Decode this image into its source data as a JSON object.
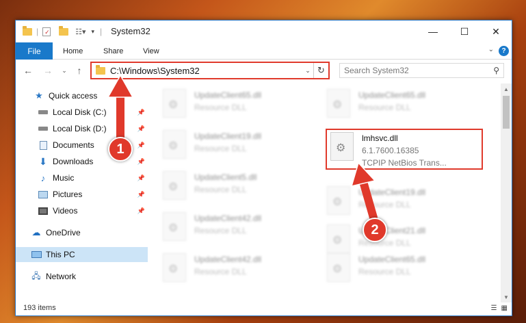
{
  "window": {
    "title": "System32",
    "minimize": "—",
    "maximize": "☐",
    "close": "✕"
  },
  "ribbon": {
    "tabs": [
      "File",
      "Home",
      "Share",
      "View"
    ],
    "help": "?"
  },
  "nav": {
    "address": "C:\\Windows\\System32",
    "search_placeholder": "Search System32"
  },
  "sidebar": {
    "items": [
      {
        "label": "Quick access",
        "icon": "star-icon"
      },
      {
        "label": "Local Disk (C:)",
        "icon": "drive-icon"
      },
      {
        "label": "Local Disk (D:)",
        "icon": "drive-icon"
      },
      {
        "label": "Documents",
        "icon": "documents-icon"
      },
      {
        "label": "Downloads",
        "icon": "download-icon"
      },
      {
        "label": "Music",
        "icon": "music-icon"
      },
      {
        "label": "Pictures",
        "icon": "pictures-icon"
      },
      {
        "label": "Videos",
        "icon": "videos-icon"
      },
      {
        "label": "OneDrive",
        "icon": "cloud-icon"
      },
      {
        "label": "This PC",
        "icon": "computer-icon"
      },
      {
        "label": "Network",
        "icon": "network-icon"
      }
    ]
  },
  "files": {
    "col1": [
      {
        "name": "UpdateClient65.dll",
        "type": "Resource DLL"
      },
      {
        "name": "UpdateClient19.dll",
        "type": "Resource DLL"
      },
      {
        "name": "UpdateClient5.dll",
        "type": "Resource DLL"
      },
      {
        "name": "UpdateClient42.dll",
        "type": "Resource DLL"
      },
      {
        "name": "UpdateClient42.dll",
        "type": "Resource DLL"
      }
    ],
    "col2": [
      {
        "name": "UpdateClient65.dll",
        "type": "Resource DLL"
      },
      {
        "name": "UpdateClient19.dll",
        "type": "Resource DLL"
      },
      {
        "name": "UpdateClient21.dll",
        "type": "Resource DLL"
      },
      {
        "name": "UpdateClient65.dll",
        "type": "Resource DLL"
      }
    ],
    "highlighted": {
      "name": "lmhsvc.dll",
      "version": "6.1.7600.16385",
      "description": "TCPIP NetBios Trans..."
    }
  },
  "status": {
    "count": "193 items"
  },
  "annotations": {
    "step1": "1",
    "step2": "2",
    "color": "#e0392b"
  }
}
